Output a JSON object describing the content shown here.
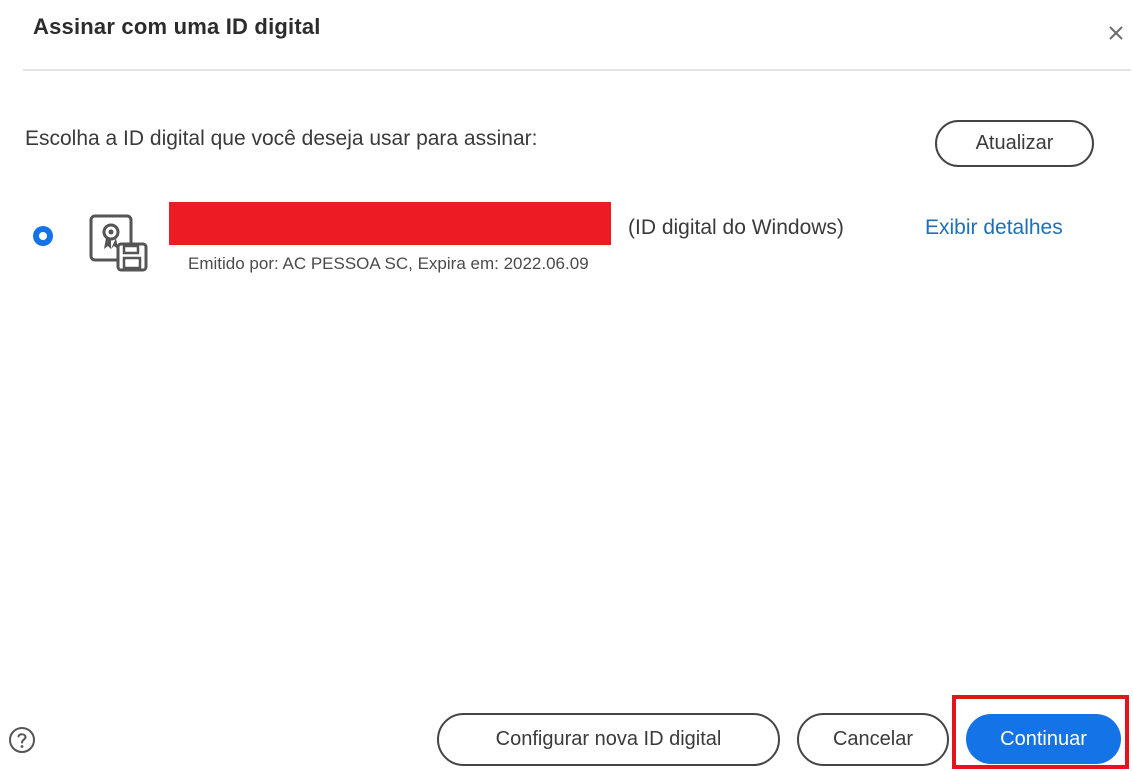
{
  "dialog": {
    "title": "Assinar com uma ID digital",
    "close_icon": "close-icon"
  },
  "prompt": "Escolha a ID digital que você deseja usar para assinar:",
  "refresh_label": "Atualizar",
  "id_list": [
    {
      "selected": true,
      "icon": "certificate-icon",
      "type_label": "(ID digital do Windows)",
      "details_link": "Exibir detalhes",
      "issuer_line": "Emitido por: AC PESSOA SC, Expira em: 2022.06.09"
    }
  ],
  "footer": {
    "help_icon": "help-icon",
    "configure_label": "Configurar nova ID digital",
    "cancel_label": "Cancelar",
    "continue_label": "Continuar"
  },
  "colors": {
    "accent": "#1473e6",
    "link": "#1d6fb8",
    "annotation_red": "#e3141c",
    "redaction_red": "#ed1c24"
  }
}
